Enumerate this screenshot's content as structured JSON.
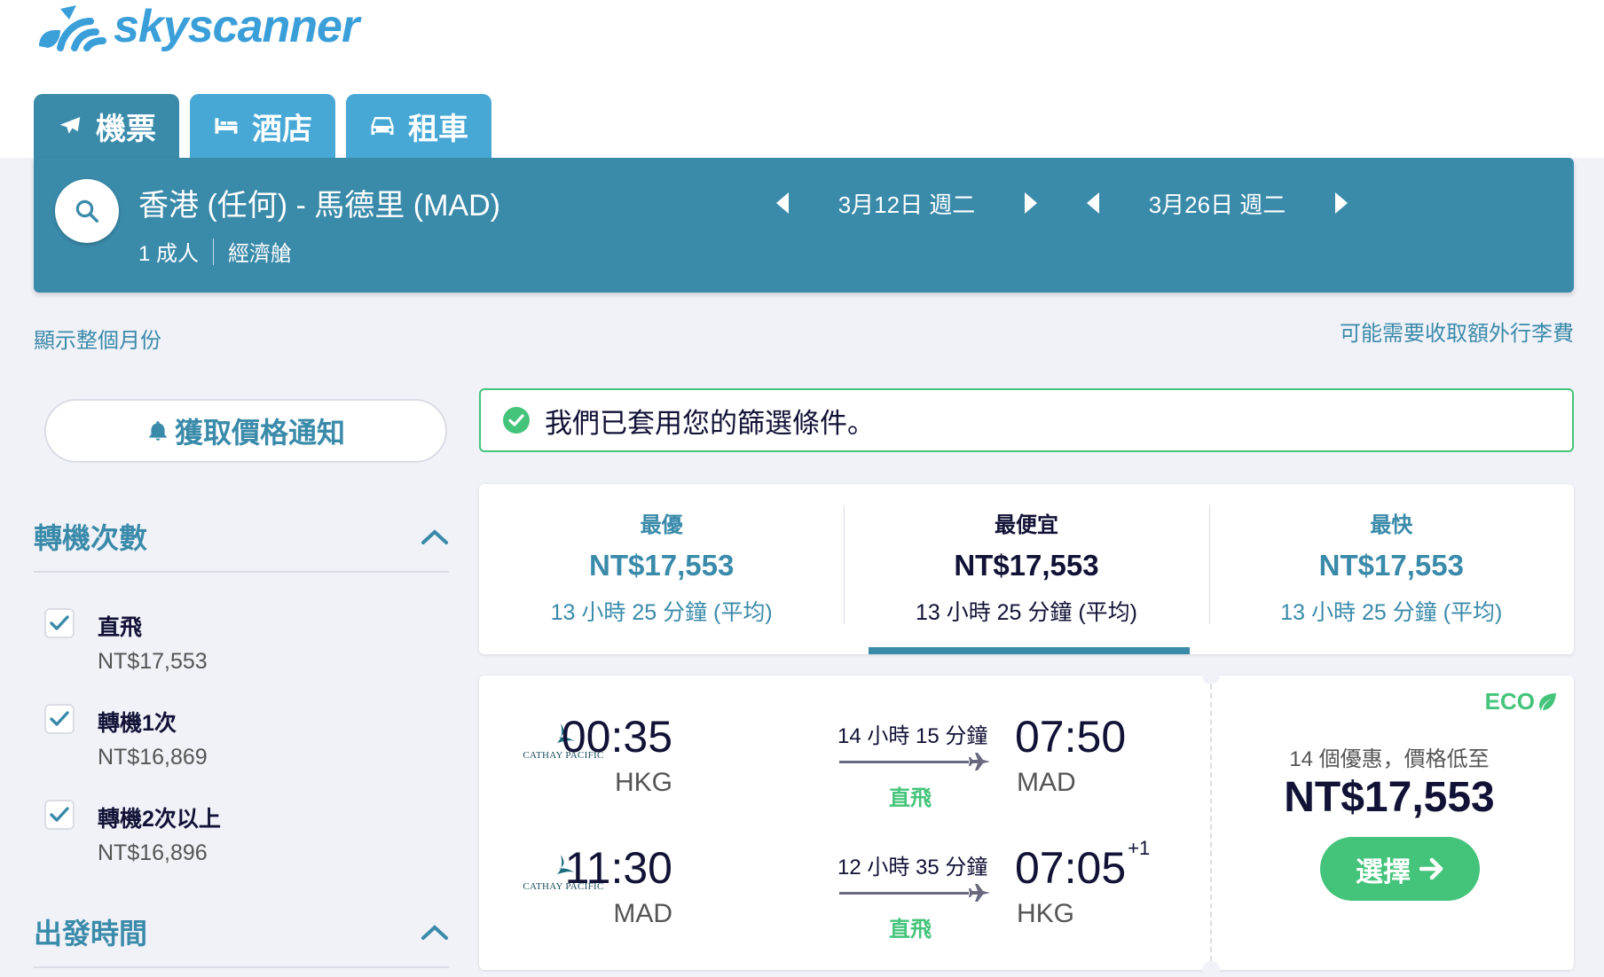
{
  "brand": {
    "name": "skyscanner"
  },
  "tabs": [
    {
      "label": "機票",
      "icon": "plane-icon"
    },
    {
      "label": "酒店",
      "icon": "bed-icon"
    },
    {
      "label": "租車",
      "icon": "car-icon"
    }
  ],
  "search": {
    "route": "香港 (任何) - 馬德里 (MAD)",
    "passengers": "1 成人",
    "cabin": "經濟艙",
    "depart_date": "3月12日 週二",
    "return_date": "3月26日 週二"
  },
  "links": {
    "show_month": "顯示整個月份",
    "baggage_fee": "可能需要收取額外行李費"
  },
  "sidebar": {
    "price_alert": "獲取價格通知",
    "stops_title": "轉機次數",
    "stops": [
      {
        "label": "直飛",
        "price": "NT$17,553",
        "checked": true
      },
      {
        "label": "轉機1次",
        "price": "NT$16,869",
        "checked": true
      },
      {
        "label": "轉機2次以上",
        "price": "NT$16,896",
        "checked": true
      }
    ],
    "depart_time_title": "出發時間"
  },
  "filter_applied": "我們已套用您的篩選條件。",
  "sort_tabs": [
    {
      "label": "最優",
      "price": "NT$17,553",
      "duration": "13 小時 25 分鐘 (平均)",
      "active": false
    },
    {
      "label": "最便宜",
      "price": "NT$17,553",
      "duration": "13 小時 25 分鐘 (平均)",
      "active": true
    },
    {
      "label": "最快",
      "price": "NT$17,553",
      "duration": "13 小時 25 分鐘 (平均)",
      "active": false
    }
  ],
  "result": {
    "legs": [
      {
        "airline": "CATHAY PACIFIC",
        "dep_time": "00:35",
        "dep_airport": "HKG",
        "duration": "14 小時 15 分鐘",
        "stops": "直飛",
        "arr_time": "07:50",
        "arr_day_offset": "",
        "arr_airport": "MAD"
      },
      {
        "airline": "CATHAY PACIFIC",
        "dep_time": "11:30",
        "dep_airport": "MAD",
        "duration": "12 小時 35 分鐘",
        "stops": "直飛",
        "arr_time": "07:05",
        "arr_day_offset": "+1",
        "arr_airport": "HKG"
      }
    ],
    "eco_label": "ECO",
    "deals_text": "14 個優惠，價格低至",
    "price": "NT$17,553",
    "select_label": "選擇"
  },
  "colors": {
    "brand_teal": "#3a8aaa",
    "tab_blue": "#47a8d6",
    "green": "#44c47a"
  }
}
